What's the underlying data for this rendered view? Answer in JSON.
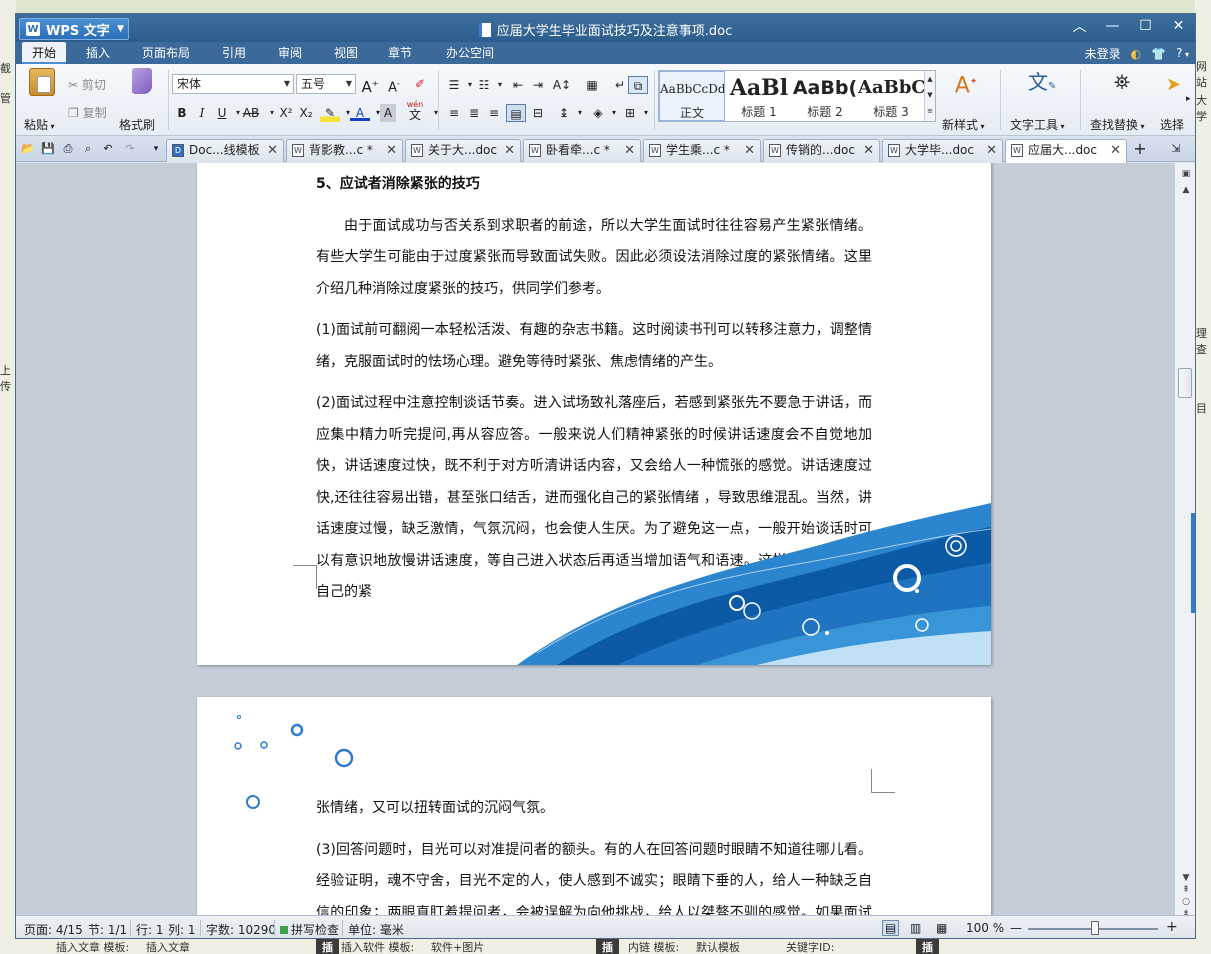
{
  "background": {
    "left_texts": [
      "截",
      "管",
      "上传"
    ],
    "right_texts": [
      "网站",
      "大学",
      "理查",
      "目"
    ],
    "bottom_texts": [
      "插入文章 模板:",
      "插入文章",
      "插",
      "插入软件 模板:",
      "软件+图片",
      "插",
      "内链 模板:",
      "默认模板",
      "关键字ID:",
      "插"
    ]
  },
  "window": {
    "app_button": "WPS 文字",
    "app_logo": "W",
    "title": "应届大学生毕业面试技巧及注意事项.doc",
    "controls": [
      "︿",
      "—",
      "☐",
      "✕"
    ]
  },
  "menu": {
    "tabs": [
      "开始",
      "插入",
      "页面布局",
      "引用",
      "审阅",
      "视图",
      "章节",
      "办公空间"
    ],
    "active": "开始",
    "login": "未登录",
    "help": "?"
  },
  "ribbon": {
    "paste": "粘贴",
    "cut": "剪切",
    "copy": "复制",
    "format_painter": "格式刷",
    "font_name": "宋体",
    "font_size": "五号",
    "bold": "B",
    "italic": "I",
    "underline": "U",
    "strike": "AB",
    "superscript": "X²",
    "subscript": "X₂",
    "font_color": "A",
    "char_shade": "A",
    "phonetic_top": "wén",
    "phonetic": "文",
    "grow": "A",
    "shrink": "A",
    "styles": [
      {
        "preview": "AaBbCcDd",
        "label": "正文"
      },
      {
        "preview": "AaBl",
        "label": "标题 1"
      },
      {
        "preview": "AaBb(",
        "label": "标题 2"
      },
      {
        "preview": "AaBbC",
        "label": "标题 3"
      }
    ],
    "new_style": "新样式",
    "text_tools": "文字工具",
    "find_replace": "查找替换",
    "select": "选择"
  },
  "doc_tabs": [
    {
      "label": "Doc...线模板",
      "icon": "D"
    },
    {
      "label": "背影教...c *",
      "icon": "W"
    },
    {
      "label": "关于大...doc",
      "icon": "W"
    },
    {
      "label": "卧看牵...c *",
      "icon": "W"
    },
    {
      "label": "学生乘...c *",
      "icon": "W"
    },
    {
      "label": "传销的...doc",
      "icon": "W"
    },
    {
      "label": "大学毕...doc",
      "icon": "W"
    },
    {
      "label": "应届大...doc",
      "icon": "W"
    }
  ],
  "doc_tab_close": "✕",
  "document": {
    "heading": "5、应试者消除紧张的技巧",
    "para_intro": "由于面试成功与否关系到求职者的前途，所以大学生面试时往往容易产生紧张情绪。有些大学生可能由于过度紧张而导致面试失败。因此必须设法消除过度的紧张情绪。这里介绍几种消除过度紧张的技巧，供同学们参考。",
    "para_1": "(1)面试前可翻阅一本轻松活泼、有趣的杂志书籍。这时阅读书刊可以转移注意力，调整情绪，克服面试时的怯场心理。避免等待时紧张、焦虑情绪的产生。",
    "para_2": "(2)面试过程中注意控制谈话节奏。进入试场致礼落座后，若感到紧张先不要急于讲话，而应集中精力听完提问,再从容应答。一般来说人们精神紧张的时候讲话速度会不自觉地加快，讲话速度过快，既不利于对方听清讲话内容，又会给人一种慌张的感觉。讲话速度过快,还往往容易出错，甚至张口结舌，进而强化自己的紧张情绪 ，导致思维混乱。当然，讲话速度过慢，缺乏激情，气氛沉闷，也会使人生厌。为了避免这一点，一般开始谈话时可以有意识地放慢讲话速度，等自己进入状态后再适当增加语气和语速。这样，既可以稳定自己的紧",
    "para_2_cont": "张情绪，又可以扭转面试的沉闷气氛。",
    "para_3": "(3)回答问题时，目光可以对准提问者的额头。有的人在回答问题时眼睛不知道往哪儿看。经验证明，魂不守舍，目光不定的人，使人感到不诚实；眼睛下垂的人，给人一种缺乏自信的印象；两眼直盯着提问者，会被误解为向他挑战，给人以桀骜不驯的感觉。如果面试时把"
  },
  "status": {
    "page": "页面: 4/15",
    "section": "节: 1/1",
    "row": "行: 1",
    "col": "列: 1",
    "words": "字数: 10290",
    "spell": "拼写检查",
    "unit": "单位: 毫米",
    "zoom": "100 %",
    "zoom_out": "—",
    "zoom_in": "+",
    "zoom_level": 0.5
  },
  "colors": {
    "accent": "#2f7bd1",
    "wave_dark": "#0c5aa6",
    "wave_light": "#3a95d8"
  }
}
